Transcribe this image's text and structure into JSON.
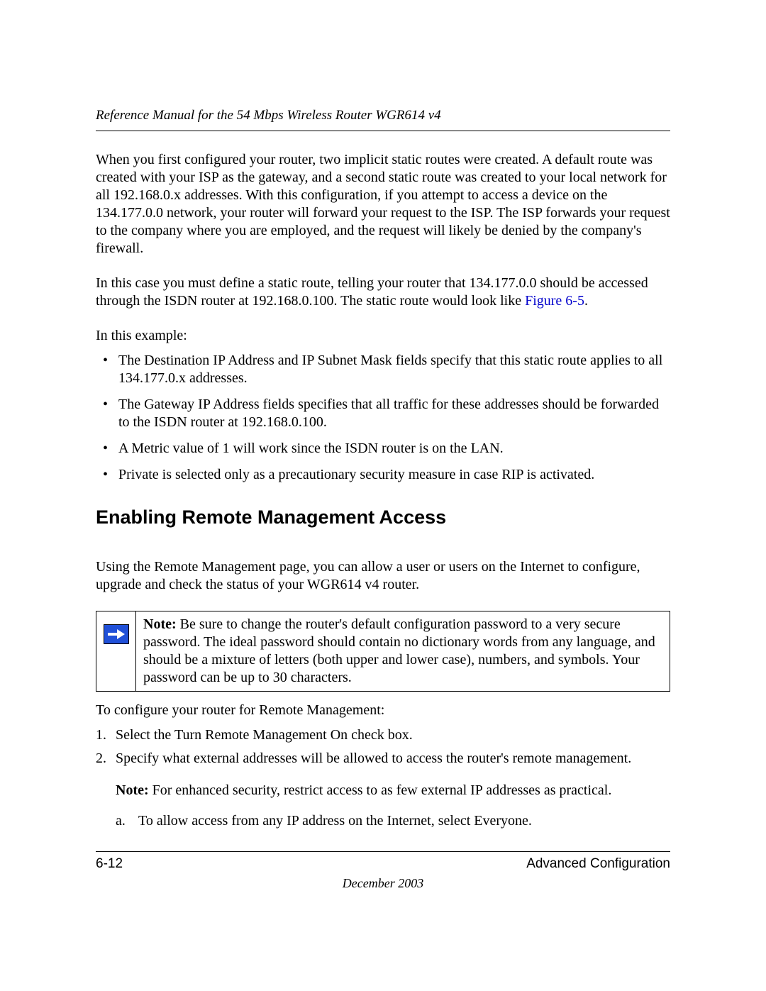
{
  "header": {
    "title": "Reference Manual for the 54 Mbps Wireless Router WGR614 v4"
  },
  "paragraphs": {
    "p1": "When you first configured your router, two implicit static routes were created. A default route was created with your ISP as the gateway, and a second static route was created to your local network for all 192.168.0.x addresses. With this configuration, if you attempt to access a device on the 134.177.0.0 network, your router will forward your request to the ISP. The ISP forwards your request to the company where you are employed, and the request will likely be denied by the company's firewall.",
    "p2_pre": "In this case you must define a static route, telling your router that 134.177.0.0 should be accessed through the ISDN router at 192.168.0.100. The static route would look like ",
    "p2_link": "Figure 6-5",
    "p2_post": ".",
    "p3": "In this example:",
    "bullets": [
      "The Destination IP Address and IP Subnet Mask fields specify that this static route applies to all 134.177.0.x addresses.",
      "The Gateway IP Address fields specifies that all traffic for these addresses should be forwarded to the ISDN router at 192.168.0.100.",
      "A Metric value of 1 will work since the ISDN router is on the LAN.",
      "Private is selected only as a precautionary security measure in case RIP is activated."
    ]
  },
  "section": {
    "heading": "Enabling Remote Management Access",
    "intro": "Using the Remote Management page, you can allow a user or users on the Internet to configure, upgrade and check the status of your WGR614 v4 router."
  },
  "note": {
    "label": "Note:",
    "text": " Be sure to change the router's default configuration password to a very secure password. The ideal password should contain no dictionary words from any language, and should be a mixture of letters (both upper and lower case), numbers, and symbols. Your password can be up to 30 characters."
  },
  "config": {
    "intro": "To configure your router for Remote Management:",
    "steps": [
      "Select the Turn Remote Management On check box.",
      "Specify what external addresses will be allowed to access the router's remote management."
    ],
    "subnote_label": "Note:",
    "subnote_text": " For enhanced security, restrict access to as few external IP addresses as practical.",
    "substeps": [
      "To allow access from any IP address on the Internet, select Everyone."
    ]
  },
  "footer": {
    "page": "6-12",
    "section": "Advanced Configuration",
    "date": "December 2003"
  }
}
